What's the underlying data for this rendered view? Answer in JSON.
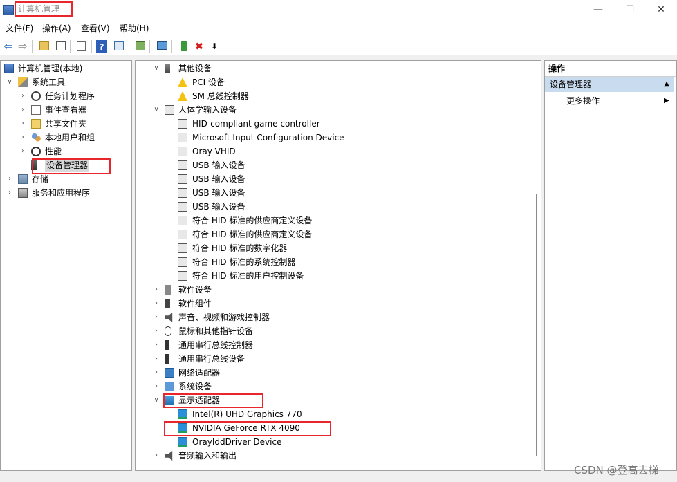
{
  "window": {
    "title": "计算机管理",
    "minimize_glyph": "—",
    "maximize_glyph": "☐",
    "close_glyph": "✕"
  },
  "menu": [
    "文件(F)",
    "操作(A)",
    "查看(V)",
    "帮助(H)"
  ],
  "toolbar": {
    "buttons": [
      "back-icon",
      "forward-icon",
      "up-folder-icon",
      "show-hide-tree-icon",
      "export-list-icon",
      "help-icon",
      "properties-pane-icon",
      "update-driver-icon",
      "monitor-icon",
      "enable-device-icon",
      "uninstall-icon",
      "disable-device-icon"
    ],
    "back_glyph": "⇦",
    "forward_glyph": "⇨",
    "help_glyph": "?",
    "uninstall_glyph": "✖",
    "download_glyph": "⬇"
  },
  "tree": [
    {
      "label": "计算机管理(本地)",
      "expander": "",
      "icon": "computer-icon"
    },
    {
      "label": "系统工具",
      "expander": "∨",
      "icon": "tools-icon"
    },
    {
      "label": "任务计划程序",
      "expander": "›",
      "icon": "task-scheduler-icon"
    },
    {
      "label": "事件查看器",
      "expander": "›",
      "icon": "event-viewer-icon"
    },
    {
      "label": "共享文件夹",
      "expander": "›",
      "icon": "shared-folder-icon"
    },
    {
      "label": "本地用户和组",
      "expander": "›",
      "icon": "users-groups-icon"
    },
    {
      "label": "性能",
      "expander": "›",
      "icon": "performance-icon"
    },
    {
      "label": "设备管理器",
      "expander": "",
      "icon": "device-manager-icon"
    },
    {
      "label": "存储",
      "expander": "›",
      "icon": "storage-icon"
    },
    {
      "label": "服务和应用程序",
      "expander": "›",
      "icon": "services-icon"
    }
  ],
  "devices": [
    {
      "label": "其他设备",
      "expander": "∨",
      "icon": "other-devices-icon"
    },
    {
      "label": "PCI 设备",
      "expander": "",
      "icon": "warning-device-icon"
    },
    {
      "label": "SM 总线控制器",
      "expander": "",
      "icon": "warning-device-icon"
    },
    {
      "label": "人体学输入设备",
      "expander": "∨",
      "icon": "hid-category-icon"
    },
    {
      "label": "HID-compliant game controller",
      "expander": "",
      "icon": "hid-device-icon"
    },
    {
      "label": "Microsoft Input Configuration Device",
      "expander": "",
      "icon": "hid-device-icon"
    },
    {
      "label": "Oray VHID",
      "expander": "",
      "icon": "hid-device-icon"
    },
    {
      "label": "USB 输入设备",
      "expander": "",
      "icon": "hid-device-icon"
    },
    {
      "label": "USB 输入设备",
      "expander": "",
      "icon": "hid-device-icon"
    },
    {
      "label": "USB 输入设备",
      "expander": "",
      "icon": "hid-device-icon"
    },
    {
      "label": "USB 输入设备",
      "expander": "",
      "icon": "hid-device-icon"
    },
    {
      "label": "符合 HID 标准的供应商定义设备",
      "expander": "",
      "icon": "hid-device-icon"
    },
    {
      "label": "符合 HID 标准的供应商定义设备",
      "expander": "",
      "icon": "hid-device-icon"
    },
    {
      "label": "符合 HID 标准的数字化器",
      "expander": "",
      "icon": "hid-device-icon"
    },
    {
      "label": "符合 HID 标准的系统控制器",
      "expander": "",
      "icon": "hid-device-icon"
    },
    {
      "label": "符合 HID 标准的用户控制设备",
      "expander": "",
      "icon": "hid-device-icon"
    },
    {
      "label": "软件设备",
      "expander": "›",
      "icon": "software-device-icon"
    },
    {
      "label": "软件组件",
      "expander": "›",
      "icon": "software-component-icon"
    },
    {
      "label": "声音、视频和游戏控制器",
      "expander": "›",
      "icon": "sound-icon"
    },
    {
      "label": "鼠标和其他指针设备",
      "expander": "›",
      "icon": "mouse-icon"
    },
    {
      "label": "通用串行总线控制器",
      "expander": "›",
      "icon": "usb-icon"
    },
    {
      "label": "通用串行总线设备",
      "expander": "›",
      "icon": "usb-icon"
    },
    {
      "label": "网络适配器",
      "expander": "›",
      "icon": "network-adapter-icon"
    },
    {
      "label": "系统设备",
      "expander": "›",
      "icon": "system-device-icon"
    },
    {
      "label": "显示适配器",
      "expander": "∨",
      "icon": "display-adapter-icon"
    },
    {
      "label": "Intel(R) UHD Graphics 770",
      "expander": "",
      "icon": "monitor-device-icon"
    },
    {
      "label": "NVIDIA GeForce RTX 4090",
      "expander": "",
      "icon": "monitor-device-icon"
    },
    {
      "label": "OrayIddDriver Device",
      "expander": "",
      "icon": "monitor-device-icon"
    },
    {
      "label": "音频输入和输出",
      "expander": "›",
      "icon": "audio-io-icon"
    }
  ],
  "actions": {
    "header": "操作",
    "section": "设备管理器",
    "section_glyph": "▲",
    "more": "更多操作",
    "more_glyph": "▶"
  },
  "watermark": "CSDN @登高去梯",
  "colors": {
    "highlight_border": "#e8262b",
    "selection": "#d9d9d9",
    "action_section_bg": "#c9dcef"
  }
}
